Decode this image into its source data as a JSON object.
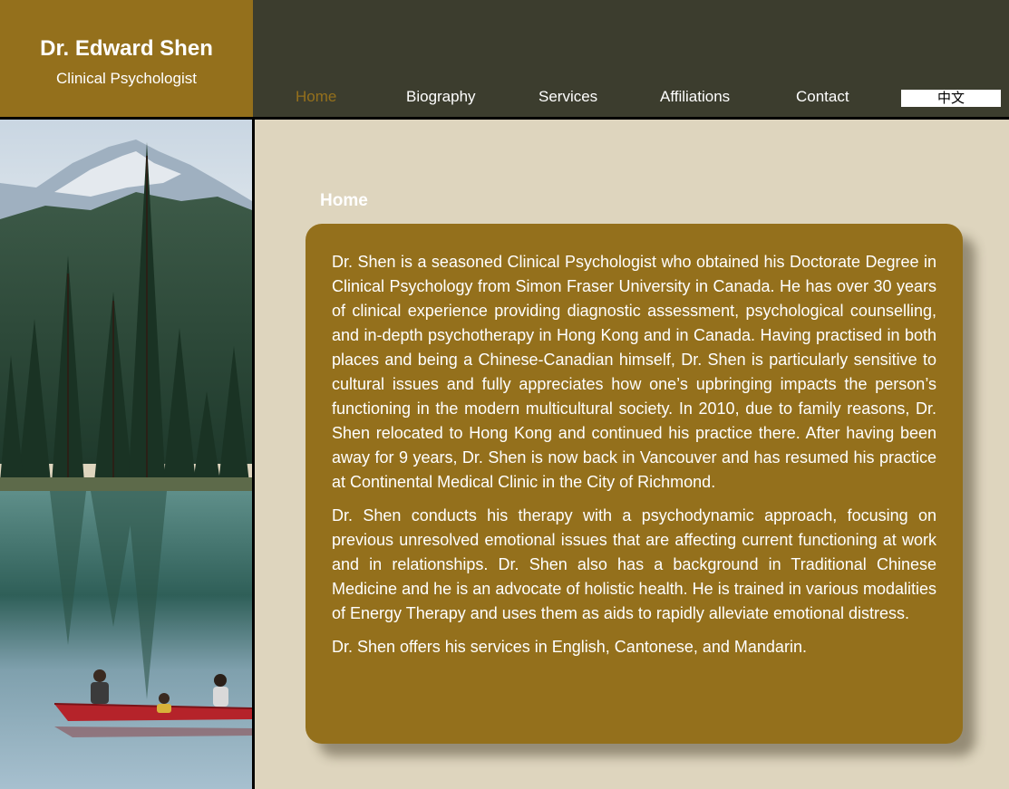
{
  "brand": {
    "name": "Dr. Edward Shen",
    "title": "Clinical Psychologist"
  },
  "nav": {
    "items": [
      {
        "label": "Home",
        "active": true
      },
      {
        "label": "Biography",
        "active": false
      },
      {
        "label": "Services",
        "active": false
      },
      {
        "label": "Affiliations",
        "active": false
      },
      {
        "label": "Contact",
        "active": false
      }
    ],
    "language_label": "中文"
  },
  "main": {
    "section_title": "Home",
    "paragraphs": [
      "Dr. Shen is a seasoned Clinical Psychologist who obtained his Doctorate Degree in Clinical Psychology from Simon Fraser University in Canada. He has over 30 years of clinical experience providing diagnostic assessment, psychological counselling, and in-depth psychotherapy in Hong Kong and in Canada. Having practised in both places and being a Chinese-Canadian himself, Dr. Shen is particularly sensitive to cultural issues and fully appreciates how one’s upbringing impacts the person’s functioning in the modern multicultural society. In 2010, due to family reasons, Dr. Shen relocated to Hong Kong and continued his practice there. After having been away for 9 years, Dr. Shen is now back in Vancouver and has resumed his practice at Continental Medical Clinic in the City of Richmond.",
      "Dr. Shen conducts his therapy with a psychodynamic approach, focusing on previous unresolved emotional issues that are affecting current functioning at work and in relationships. Dr. Shen also has a background in Traditional Chinese Medicine and he is an advocate of holistic health. He is trained in various modalities of Energy Therapy and uses them as aids to rapidly alleviate emotional distress.",
      "Dr. Shen offers his services in English, Cantonese, and Mandarin."
    ]
  },
  "colors": {
    "brand": "#94701c",
    "topbar": "#3c3d2e",
    "background": "#ded5be",
    "nav_active": "#94701c"
  }
}
